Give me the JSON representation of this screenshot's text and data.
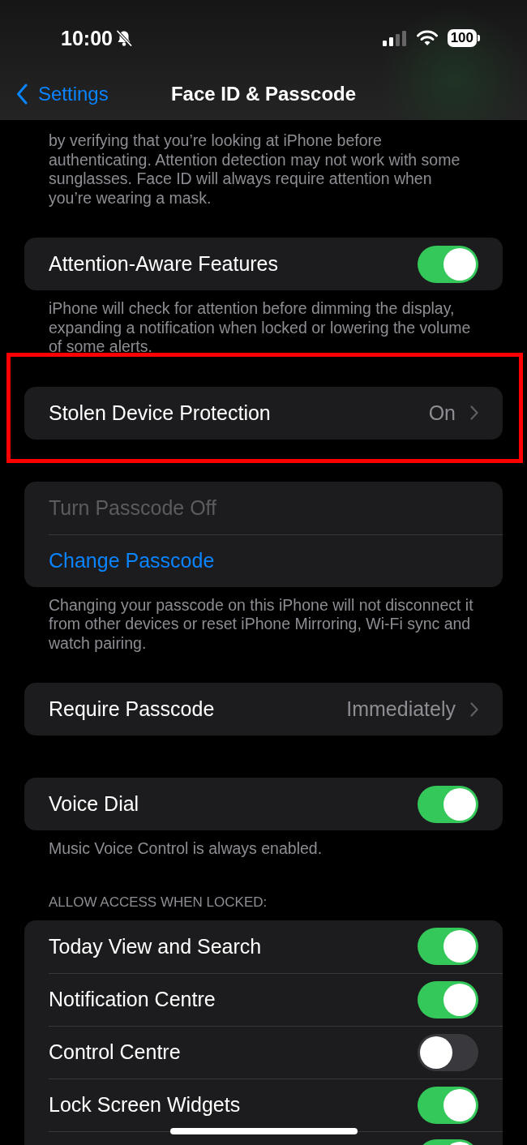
{
  "status_bar": {
    "time": "10:00",
    "silent": true,
    "battery": "100"
  },
  "nav": {
    "back": "Settings",
    "title": "Face ID & Passcode"
  },
  "sections": [
    {
      "footer": "by verifying that you’re looking at iPhone before authenticating. Attention detection may not work with some sunglasses. Face ID will always require attention when you’re wearing a mask."
    },
    {
      "rows": [
        {
          "kind": "toggle",
          "label": "Attention-Aware Features",
          "on": true
        }
      ],
      "footer": "iPhone will check for attention before dimming the display, expanding a notification when locked or lowering the volume of some alerts."
    },
    {
      "highlighted": true,
      "rows": [
        {
          "kind": "detail",
          "label": "Stolen Device Protection",
          "value": "On"
        }
      ]
    },
    {
      "rows": [
        {
          "kind": "action",
          "label": "Turn Passcode Off",
          "disabled": true
        },
        {
          "kind": "action",
          "label": "Change Passcode",
          "disabled": false
        }
      ],
      "footer": "Changing your passcode on this iPhone will not disconnect it from other devices or reset iPhone Mirroring, Wi-Fi sync and watch pairing."
    },
    {
      "rows": [
        {
          "kind": "detail",
          "label": "Require Passcode",
          "value": "Immediately"
        }
      ]
    },
    {
      "rows": [
        {
          "kind": "toggle",
          "label": "Voice Dial",
          "on": true
        }
      ],
      "footer": "Music Voice Control is always enabled."
    },
    {
      "header": "ALLOW ACCESS WHEN LOCKED:",
      "rows": [
        {
          "kind": "toggle",
          "label": "Today View and Search",
          "on": true
        },
        {
          "kind": "toggle",
          "label": "Notification Centre",
          "on": true
        },
        {
          "kind": "toggle",
          "label": "Control Centre",
          "on": false
        },
        {
          "kind": "toggle",
          "label": "Lock Screen Widgets",
          "on": true
        },
        {
          "kind": "toggle",
          "on": true
        }
      ]
    }
  ]
}
